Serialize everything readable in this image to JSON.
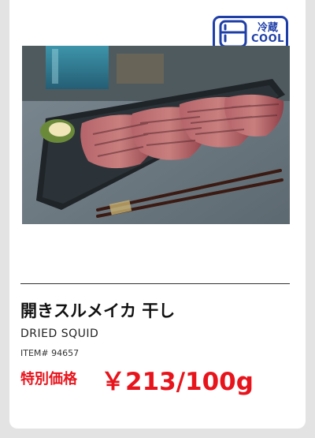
{
  "badge": {
    "icon": "refrigerator-icon",
    "label_jp": "冷蔵",
    "label_en": "COOL",
    "color": "#1f3fa8"
  },
  "product": {
    "image": "dried-squid-photo",
    "name_jp": "開きスルメイカ 干し",
    "name_en": "DRIED SQUID",
    "item_number": "ITEM# 94657"
  },
  "price": {
    "label": "特別価格",
    "value": "￥213/100g",
    "color": "#e8141c"
  }
}
